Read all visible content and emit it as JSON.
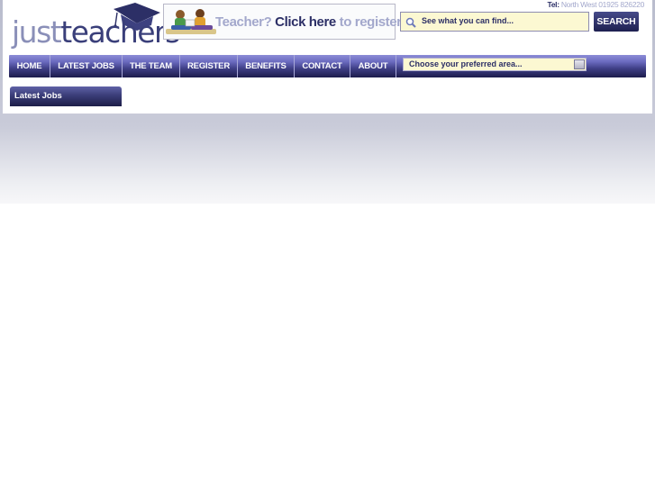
{
  "logo": {
    "part1": "just",
    "part2": "teachers"
  },
  "banner": {
    "part1": "Teacher?",
    "part2": "Click here",
    "part3": "to register"
  },
  "tel": {
    "label": "Tel:",
    "number": "North West 01925 826220"
  },
  "search": {
    "placeholder": "See what you can find...",
    "button_label": "SEARCH"
  },
  "nav": {
    "items": [
      {
        "label": "HOME"
      },
      {
        "label": "LATEST JOBS"
      },
      {
        "label": "THE TEAM"
      },
      {
        "label": "REGISTER"
      },
      {
        "label": "BENEFITS"
      },
      {
        "label": "CONTACT"
      },
      {
        "label": "ABOUT"
      }
    ],
    "area_select": {
      "value": "Choose your preferred area..."
    }
  },
  "tab": {
    "label": "Latest Jobs"
  },
  "colors": {
    "brand_dark": "#2c2f66",
    "brand_light": "#a3a8cc",
    "input_bg": "#fcf8d2"
  },
  "icons": [
    "graduation-cap-icon",
    "search-icon",
    "dropdown-arrow-icon"
  ]
}
